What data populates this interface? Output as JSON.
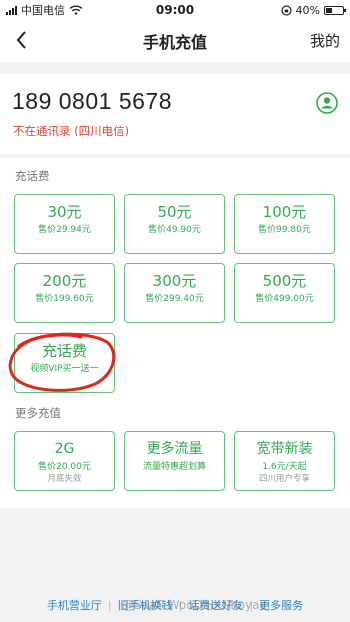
{
  "status_bar": {
    "carrier": "中国电信",
    "time": "09:00",
    "battery": "40%",
    "battery_level": 0.4
  },
  "nav": {
    "title": "手机充值",
    "right": "我的"
  },
  "account": {
    "phone": "189 0801 5678",
    "note": "不在通讯录 (四川电信)"
  },
  "section_fee": "充话费",
  "fee_cards": [
    {
      "amount": "30元",
      "price": "售价29.94元"
    },
    {
      "amount": "50元",
      "price": "售价49.90元"
    },
    {
      "amount": "100元",
      "price": "售价99.80元"
    },
    {
      "amount": "200元",
      "price": "售价199.60元"
    },
    {
      "amount": "300元",
      "price": "售价299.40元"
    },
    {
      "amount": "500元",
      "price": "售价499.00元"
    }
  ],
  "promo_card": {
    "title": "充话费",
    "subtitle": "视频VIP买一送一"
  },
  "section_more": "更多充值",
  "more_cards": [
    {
      "title": "2G",
      "subtitle": "售价20.00元",
      "note": "月底失效"
    },
    {
      "title": "更多流量",
      "subtitle": "流量特惠超划算",
      "note": ""
    },
    {
      "title": "宽带新装",
      "subtitle": "1.6元/天起",
      "note": "四川用户专享"
    }
  ],
  "footer": {
    "links": [
      "手机营业厅",
      "旧手机换钱",
      "话费送好友",
      "更多服务"
    ]
  },
  "watermark": "@SaaS WooDaoU/Koyaei",
  "colors": {
    "accent": "#33a853",
    "border": "#66c27a",
    "warning": "#e94235",
    "link": "#2a84c9",
    "annotation": "#e0261d"
  }
}
